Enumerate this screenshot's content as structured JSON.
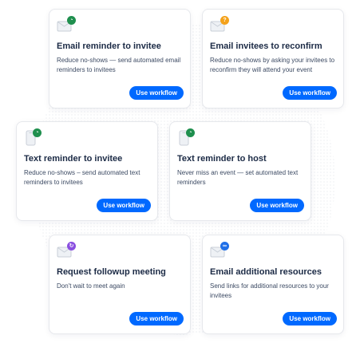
{
  "cards": [
    {
      "title": "Email reminder to invitee",
      "desc": "Reduce no-shows — send automated email reminders to invitees",
      "button": "Use workflow",
      "icon": "envelope-clock-icon",
      "badge_color": "#1f8f4e"
    },
    {
      "title": "Email invitees to reconfirm",
      "desc": "Reduce no-shows by asking your invitees to reconfirm they will attend your event",
      "button": "Use workflow",
      "icon": "envelope-question-icon",
      "badge_color": "#f4a21b"
    },
    {
      "title": "Text reminder to invitee",
      "desc": "Reduce no-shows – send automated text reminders to invitees",
      "button": "Use workflow",
      "icon": "phone-clock-icon",
      "badge_color": "#1f8f4e"
    },
    {
      "title": "Text reminder to host",
      "desc": "Never miss an event — set automated text reminders",
      "button": "Use workflow",
      "icon": "phone-clock-icon",
      "badge_color": "#1f8f4e"
    },
    {
      "title": "Request followup meeting",
      "desc": "Don't wait to meet again",
      "button": "Use workflow",
      "icon": "envelope-refresh-icon",
      "badge_color": "#8a4fe0"
    },
    {
      "title": "Email additional resources",
      "desc": "Send links for additional resources to your invitees",
      "button": "Use workflow",
      "icon": "envelope-link-icon",
      "badge_color": "#1f6fe8"
    }
  ],
  "colors": {
    "accent": "#0069ff"
  }
}
